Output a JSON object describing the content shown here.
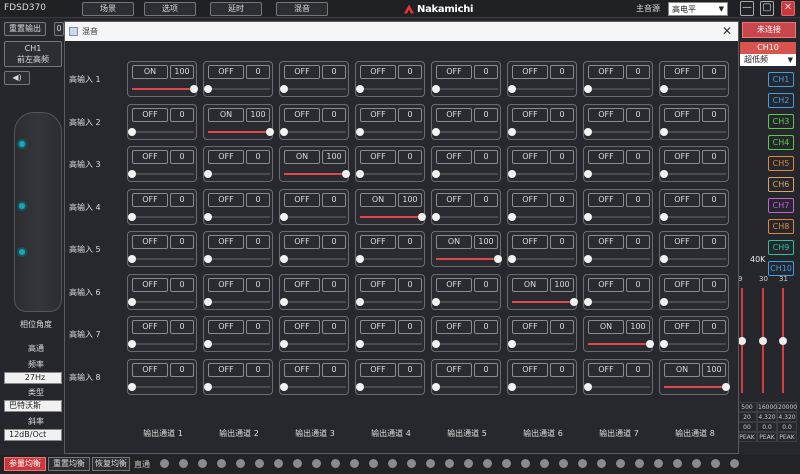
{
  "app": {
    "title": "FDSD370",
    "menus": [
      "场景",
      "选项",
      "延时",
      "混音"
    ],
    "logo_text": "Nakamichi",
    "source_label": "主音源",
    "source_value": "高电平",
    "win_controls": [
      "—",
      "▢",
      "✕"
    ],
    "bg_close": "✕"
  },
  "left": {
    "reset_output": "重置输出",
    "ch_label": "CH1",
    "ch_sub": "前左高频",
    "speaker_icon": "◀)",
    "phase_label": "相位角度",
    "highpass": "高通",
    "freq_label": "频率",
    "freq_value": "27Hz",
    "type_label": "类型",
    "type_value": "巴特沃斯",
    "slope_label": "斜率",
    "slope_value": "12dB/Oct",
    "btn_fragment": "0"
  },
  "right": {
    "not_connected": "未连接",
    "ch10_label": "CH10",
    "sub_label": "超低频",
    "freq_40k": "40K",
    "channels": [
      {
        "label": "CH1",
        "color": "#3aa0e8"
      },
      {
        "label": "CH2",
        "color": "#3aa0e8"
      },
      {
        "label": "CH3",
        "color": "#5bc94f"
      },
      {
        "label": "CH4",
        "color": "#5bc94f"
      },
      {
        "label": "CH5",
        "color": "#e0873a"
      },
      {
        "label": "CH6",
        "color": "#e0a36a"
      },
      {
        "label": "CH7",
        "color": "#c45fd6"
      },
      {
        "label": "CH8",
        "color": "#e0873a"
      },
      {
        "label": "CH9",
        "color": "#2bbfa0"
      },
      {
        "label": "CH10",
        "color": "#3aa0e8"
      }
    ],
    "fader_numbers": [
      "9",
      "30",
      "31"
    ],
    "fader_levels": [
      0.5,
      0.5,
      0.5
    ],
    "peak_rows": [
      [
        "500",
        "16000",
        "20000"
      ],
      [
        "20",
        "4.320",
        "4.320"
      ],
      [
        "00",
        "0.0",
        "0.0"
      ],
      [
        "PEAK",
        "PEAK",
        "PEAK"
      ]
    ]
  },
  "bottom": {
    "buttons": [
      "参量均衡",
      "重置均衡",
      "恢复均衡"
    ],
    "direct": "直通"
  },
  "dialog": {
    "title": "混音",
    "close": "✕",
    "rows": [
      "高输入 1",
      "高输入 2",
      "高输入 3",
      "高输入 4",
      "高输入 5",
      "高输入 6",
      "高输入 7",
      "高输入 8"
    ],
    "columns": [
      "输出通道 1",
      "输出通道 2",
      "输出通道 3",
      "输出通道 4",
      "输出通道 5",
      "输出通道 6",
      "输出通道 7",
      "输出通道 8"
    ],
    "matrix": [
      [
        {
          "state": "ON",
          "value": "100"
        },
        {
          "state": "OFF",
          "value": "0"
        },
        {
          "state": "OFF",
          "value": "0"
        },
        {
          "state": "OFF",
          "value": "0"
        },
        {
          "state": "OFF",
          "value": "0"
        },
        {
          "state": "OFF",
          "value": "0"
        },
        {
          "state": "OFF",
          "value": "0"
        },
        {
          "state": "OFF",
          "value": "0"
        }
      ],
      [
        {
          "state": "OFF",
          "value": "0"
        },
        {
          "state": "ON",
          "value": "100"
        },
        {
          "state": "OFF",
          "value": "0"
        },
        {
          "state": "OFF",
          "value": "0"
        },
        {
          "state": "OFF",
          "value": "0"
        },
        {
          "state": "OFF",
          "value": "0"
        },
        {
          "state": "OFF",
          "value": "0"
        },
        {
          "state": "OFF",
          "value": "0"
        }
      ],
      [
        {
          "state": "OFF",
          "value": "0"
        },
        {
          "state": "OFF",
          "value": "0"
        },
        {
          "state": "ON",
          "value": "100"
        },
        {
          "state": "OFF",
          "value": "0"
        },
        {
          "state": "OFF",
          "value": "0"
        },
        {
          "state": "OFF",
          "value": "0"
        },
        {
          "state": "OFF",
          "value": "0"
        },
        {
          "state": "OFF",
          "value": "0"
        }
      ],
      [
        {
          "state": "OFF",
          "value": "0"
        },
        {
          "state": "OFF",
          "value": "0"
        },
        {
          "state": "OFF",
          "value": "0"
        },
        {
          "state": "ON",
          "value": "100"
        },
        {
          "state": "OFF",
          "value": "0"
        },
        {
          "state": "OFF",
          "value": "0"
        },
        {
          "state": "OFF",
          "value": "0"
        },
        {
          "state": "OFF",
          "value": "0"
        }
      ],
      [
        {
          "state": "OFF",
          "value": "0"
        },
        {
          "state": "OFF",
          "value": "0"
        },
        {
          "state": "OFF",
          "value": "0"
        },
        {
          "state": "OFF",
          "value": "0"
        },
        {
          "state": "ON",
          "value": "100"
        },
        {
          "state": "OFF",
          "value": "0"
        },
        {
          "state": "OFF",
          "value": "0"
        },
        {
          "state": "OFF",
          "value": "0"
        }
      ],
      [
        {
          "state": "OFF",
          "value": "0"
        },
        {
          "state": "OFF",
          "value": "0"
        },
        {
          "state": "OFF",
          "value": "0"
        },
        {
          "state": "OFF",
          "value": "0"
        },
        {
          "state": "OFF",
          "value": "0"
        },
        {
          "state": "ON",
          "value": "100"
        },
        {
          "state": "OFF",
          "value": "0"
        },
        {
          "state": "OFF",
          "value": "0"
        }
      ],
      [
        {
          "state": "OFF",
          "value": "0"
        },
        {
          "state": "OFF",
          "value": "0"
        },
        {
          "state": "OFF",
          "value": "0"
        },
        {
          "state": "OFF",
          "value": "0"
        },
        {
          "state": "OFF",
          "value": "0"
        },
        {
          "state": "OFF",
          "value": "0"
        },
        {
          "state": "ON",
          "value": "100"
        },
        {
          "state": "OFF",
          "value": "0"
        }
      ],
      [
        {
          "state": "OFF",
          "value": "0"
        },
        {
          "state": "OFF",
          "value": "0"
        },
        {
          "state": "OFF",
          "value": "0"
        },
        {
          "state": "OFF",
          "value": "0"
        },
        {
          "state": "OFF",
          "value": "0"
        },
        {
          "state": "OFF",
          "value": "0"
        },
        {
          "state": "OFF",
          "value": "0"
        },
        {
          "state": "ON",
          "value": "100"
        }
      ]
    ]
  },
  "colors": {
    "accent_red": "#e0484c",
    "knob": "#f2f2f2"
  }
}
